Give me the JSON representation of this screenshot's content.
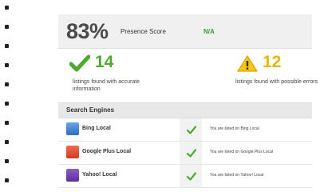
{
  "presence": {
    "score": "83%",
    "label": "Presence Score",
    "status": "N/A"
  },
  "stats": {
    "accurate": {
      "count": "14",
      "description": "listings found with accurate information",
      "icon": "checkmark-icon",
      "color": "#4caa2e"
    },
    "errors": {
      "count": "12",
      "description": "listings found with possible errors",
      "icon": "warning-icon",
      "color": "#e8b500"
    }
  },
  "engines": {
    "title": "Search Engines",
    "rows": [
      {
        "name": "Bing Local",
        "status": "You are listed on Bing Local",
        "icon": "bing-logo-icon"
      },
      {
        "name": "Google Plus Local",
        "status": "You are listed on Google Plus Local",
        "icon": "google-logo-icon"
      },
      {
        "name": "Yahoo! Local",
        "status": "You are listed on Yahoo! Local",
        "icon": "yahoo-logo-icon"
      }
    ]
  }
}
